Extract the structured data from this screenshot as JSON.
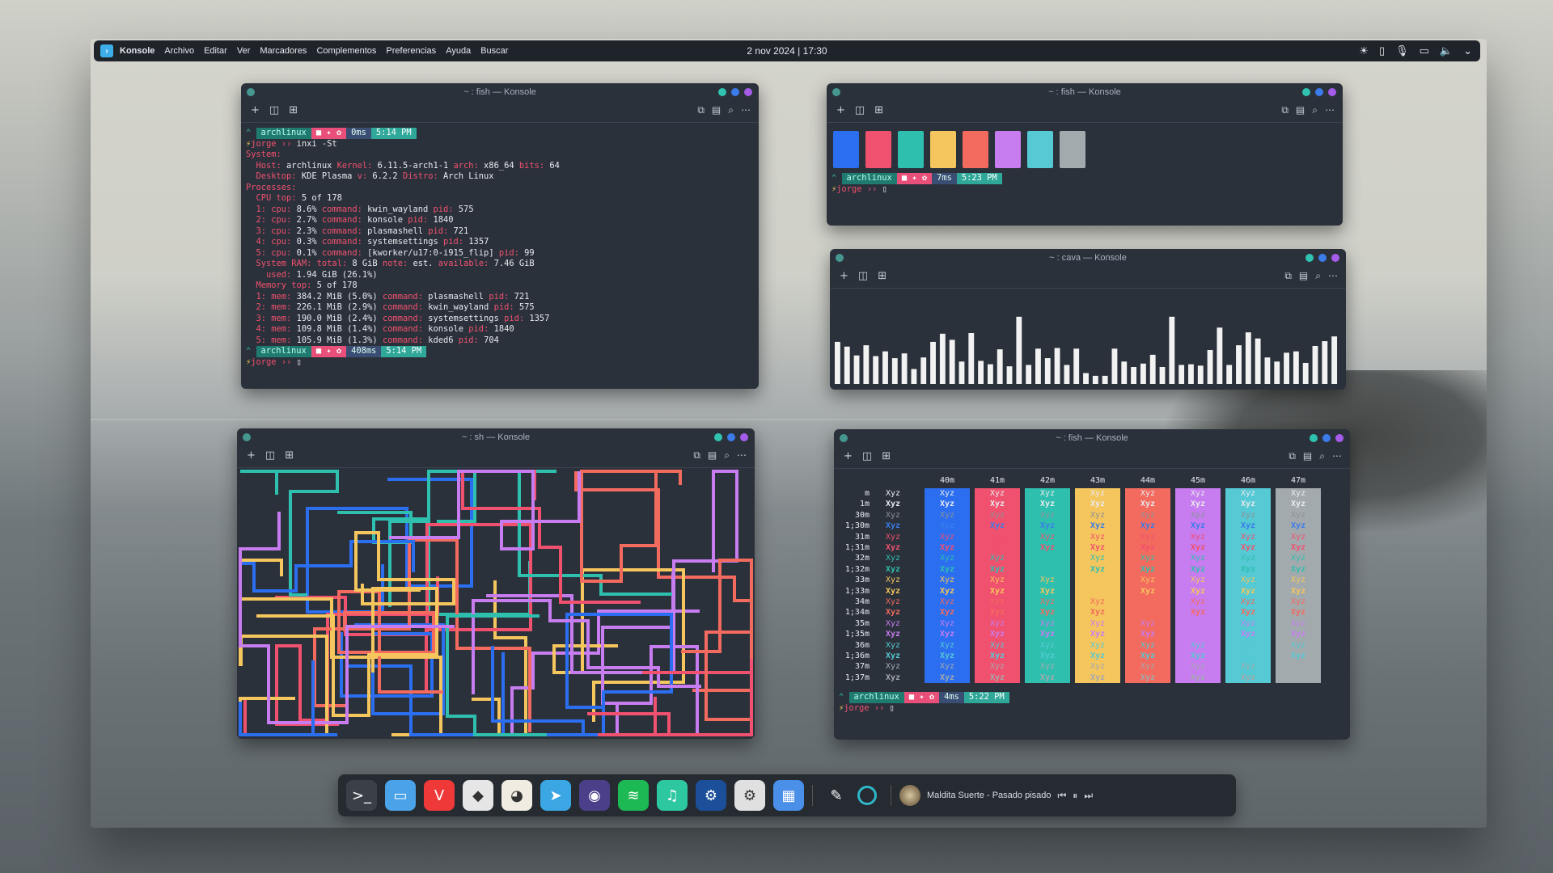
{
  "panel": {
    "app": "Konsole",
    "menu": [
      "Archivo",
      "Editar",
      "Ver",
      "Marcadores",
      "Complementos",
      "Preferencias",
      "Ayuda",
      "Buscar"
    ],
    "clock": "2 nov 2024 | 17:30",
    "tray_icons": [
      "brightness-icon",
      "clipboard-icon",
      "microphone-icon",
      "display-icon",
      "volume-icon",
      "chevron-down-icon"
    ]
  },
  "windows": {
    "w1": {
      "title": "~ : fish — Konsole"
    },
    "w2": {
      "title": "~ : fish — Konsole"
    },
    "w3": {
      "title": "~ : cava — Konsole"
    },
    "w4": {
      "title": "~ : sh — Konsole"
    },
    "w5": {
      "title": "~ : fish — Konsole"
    }
  },
  "prompt": {
    "host": "archlinux",
    "user": "jorge",
    "arrow": "››"
  },
  "inxi": {
    "cmd": "inxi -St",
    "ms1": "0ms",
    "time1": "5:14 PM",
    "ms2": "408ms",
    "time2": "5:14 PM",
    "lines": [
      "System:",
      "  Host: archlinux Kernel: 6.11.5-arch1-1 arch: x86_64 bits: 64",
      "  Desktop: KDE Plasma v: 6.2.2 Distro: Arch Linux",
      "Processes:",
      "  CPU top: 5 of 178",
      "  1: cpu: 8.6% command: kwin_wayland pid: 575",
      "  2: cpu: 2.7% command: konsole pid: 1840",
      "  3: cpu: 2.3% command: plasmashell pid: 721",
      "  4: cpu: 0.3% command: systemsettings pid: 1357",
      "  5: cpu: 0.1% command: [kworker/u17:0-i915_flip] pid: 99",
      "  System RAM: total: 8 GiB note: est. available: 7.46 GiB",
      "    used: 1.94 GiB (26.1%)",
      "  Memory top: 5 of 178",
      "  1: mem: 384.2 MiB (5.0%) command: plasmashell pid: 721",
      "  2: mem: 226.1 MiB (2.9%) command: kwin_wayland pid: 575",
      "  3: mem: 190.0 MiB (2.4%) command: systemsettings pid: 1357",
      "  4: mem: 109.8 MiB (1.4%) command: konsole pid: 1840",
      "  5: mem: 105.9 MiB (1.3%) command: kded6 pid: 704"
    ]
  },
  "swatch_prompt": {
    "ms": "7ms",
    "time": "5:23 PM"
  },
  "swatch_colors": [
    "#2b6ef0",
    "#f0516e",
    "#2fbfae",
    "#f5c65e",
    "#f36a5e",
    "#c77cf0",
    "#55c9d4",
    "#a3aaad"
  ],
  "cava_bars": [
    0.62,
    0.55,
    0.42,
    0.57,
    0.41,
    0.48,
    0.38,
    0.45,
    0.22,
    0.39,
    0.62,
    0.74,
    0.65,
    0.33,
    0.75,
    0.34,
    0.29,
    0.51,
    0.26,
    0.99,
    0.28,
    0.52,
    0.38,
    0.53,
    0.28,
    0.52,
    0.16,
    0.12,
    0.12,
    0.52,
    0.33,
    0.25,
    0.3,
    0.43,
    0.25,
    0.99,
    0.28,
    0.29,
    0.27,
    0.5,
    0.83,
    0.28,
    0.57,
    0.76,
    0.67,
    0.39,
    0.33,
    0.46,
    0.48,
    0.31,
    0.56,
    0.63,
    0.7
  ],
  "color_table": {
    "columns": [
      "40m",
      "41m",
      "42m",
      "43m",
      "44m",
      "45m",
      "46m",
      "47m"
    ],
    "rows": [
      "m",
      "1m",
      "30m",
      "1;30m",
      "31m",
      "1;31m",
      "32m",
      "1;32m",
      "33m",
      "1;33m",
      "34m",
      "1;34m",
      "35m",
      "1;35m",
      "36m",
      "1;36m",
      "37m",
      "1;37m"
    ],
    "sample": "Xyz",
    "bg_colors": [
      "#2b6ef0",
      "#f0516e",
      "#2fbfae",
      "#f5c65e",
      "#f36a5e",
      "#c77cf0",
      "#55c9d4",
      "#a3aaad"
    ],
    "fg_colors": [
      "#e8eaee",
      "#e8eaee",
      "#8c9198",
      "#3b7bea",
      "#f0516e",
      "#f0516e",
      "#2fbfae",
      "#2fbfae",
      "#f5c65e",
      "#f5c65e",
      "#f36a5e",
      "#f36a5e",
      "#c77cf0",
      "#c77cf0",
      "#55c9d4",
      "#55c9d4",
      "#a3aaad",
      "#a3aaad"
    ],
    "prompt_ms": "4ms",
    "prompt_time": "5:22 PM"
  },
  "dock": {
    "apps": [
      {
        "name": "konsole-icon",
        "glyph": ">_",
        "bg": "#3b4048"
      },
      {
        "name": "files-icon",
        "glyph": "▭",
        "bg": "#4aa3e8"
      },
      {
        "name": "vivaldi-icon",
        "glyph": "V",
        "bg": "#ef3939"
      },
      {
        "name": "inkscape-icon",
        "glyph": "◆",
        "bg": "#e6e6e6"
      },
      {
        "name": "gimp-icon",
        "glyph": "◕",
        "bg": "#f1ece2"
      },
      {
        "name": "telegram-icon",
        "glyph": "➤",
        "bg": "#3aa7e4"
      },
      {
        "name": "tor-browser-icon",
        "glyph": "◉",
        "bg": "#4b3f8a"
      },
      {
        "name": "spotify-icon",
        "glyph": "≋",
        "bg": "#1db954"
      },
      {
        "name": "music-icon",
        "glyph": "♫",
        "bg": "#2ec8a0"
      },
      {
        "name": "steam-icon",
        "glyph": "⚙",
        "bg": "#1b4f9a"
      },
      {
        "name": "settings-icon",
        "glyph": "⚙",
        "bg": "#e0e0e0"
      },
      {
        "name": "discover-icon",
        "glyph": "▦",
        "bg": "#4a8fe8"
      }
    ],
    "media_title": "Maldita Suerte - Pasado pisado"
  }
}
